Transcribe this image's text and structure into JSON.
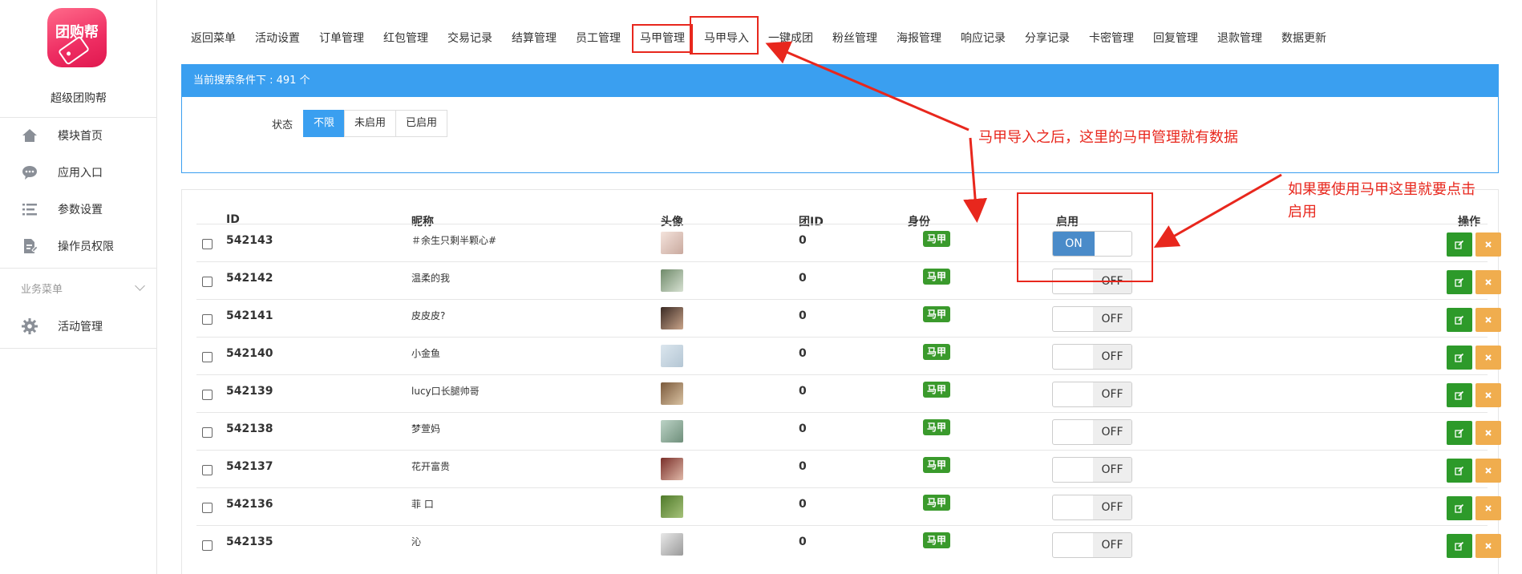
{
  "sidebar": {
    "logo_text": "团购帮",
    "site_name": "超级团购帮",
    "items": [
      {
        "label": "模块首页",
        "icon": "home-icon"
      },
      {
        "label": "应用入口",
        "icon": "chat-bubble-icon"
      },
      {
        "label": "参数设置",
        "icon": "list-settings-icon"
      },
      {
        "label": "操作员权限",
        "icon": "document-edit-icon"
      }
    ],
    "group_label": "业务菜单",
    "group_items": [
      {
        "label": "活动管理",
        "icon": "gear-icon"
      }
    ]
  },
  "tabs": [
    {
      "label": "返回菜单",
      "active": false
    },
    {
      "label": "活动设置",
      "active": false
    },
    {
      "label": "订单管理",
      "active": false
    },
    {
      "label": "红包管理",
      "active": false
    },
    {
      "label": "交易记录",
      "active": false
    },
    {
      "label": "结算管理",
      "active": false
    },
    {
      "label": "员工管理",
      "active": false
    },
    {
      "label": "马甲管理",
      "active": true
    },
    {
      "label": "马甲导入",
      "active": false
    },
    {
      "label": "一键成团",
      "active": false
    },
    {
      "label": "粉丝管理",
      "active": false
    },
    {
      "label": "海报管理",
      "active": false
    },
    {
      "label": "响应记录",
      "active": false
    },
    {
      "label": "分享记录",
      "active": false
    },
    {
      "label": "卡密管理",
      "active": false
    },
    {
      "label": "回复管理",
      "active": false
    },
    {
      "label": "退款管理",
      "active": false
    },
    {
      "label": "数据更新",
      "active": false
    }
  ],
  "search_panel": {
    "header": "当前搜索条件下 : 491 个",
    "status_label": "状态",
    "status_options": [
      "不限",
      "未启用",
      "已启用"
    ],
    "status_selected": "不限"
  },
  "table": {
    "headers": {
      "id": "ID",
      "nickname": "昵称",
      "avatar": "头像",
      "group_id": "团ID",
      "identity": "身份",
      "enabled": "启用",
      "actions": "操作"
    },
    "rows": [
      {
        "id": "542143",
        "nickname": "＃余生只剩半颗心#",
        "group_id": "0",
        "identity": "马甲",
        "enabled": "ON"
      },
      {
        "id": "542142",
        "nickname": "温柔的我",
        "group_id": "0",
        "identity": "马甲",
        "enabled": "OFF"
      },
      {
        "id": "542141",
        "nickname": "皮皮皮?",
        "group_id": "0",
        "identity": "马甲",
        "enabled": "OFF"
      },
      {
        "id": "542140",
        "nickname": "小金鱼",
        "group_id": "0",
        "identity": "马甲",
        "enabled": "OFF"
      },
      {
        "id": "542139",
        "nickname": "lucy口长腿帅哥",
        "group_id": "0",
        "identity": "马甲",
        "enabled": "OFF"
      },
      {
        "id": "542138",
        "nickname": "梦萱妈",
        "group_id": "0",
        "identity": "马甲",
        "enabled": "OFF"
      },
      {
        "id": "542137",
        "nickname": "花开富贵",
        "group_id": "0",
        "identity": "马甲",
        "enabled": "OFF"
      },
      {
        "id": "542136",
        "nickname": "菲 口",
        "group_id": "0",
        "identity": "马甲",
        "enabled": "OFF"
      },
      {
        "id": "542135",
        "nickname": "沁",
        "group_id": "0",
        "identity": "马甲",
        "enabled": "OFF"
      }
    ]
  },
  "annotations": {
    "note1": "马甲导入之后，这里的马甲管理就有数据",
    "note2_line1": "如果要使用马甲这里就要点击",
    "note2_line2": "启用"
  },
  "colors": {
    "accent": "#3a9ff0",
    "brand": "#ee2d62",
    "badge_green": "#3a9a2c",
    "edit_green": "#2d9a2a",
    "delete_orange": "#f0ad4e",
    "toggle_on": "#4a8bc9",
    "annotation_red": "#e8271d"
  }
}
